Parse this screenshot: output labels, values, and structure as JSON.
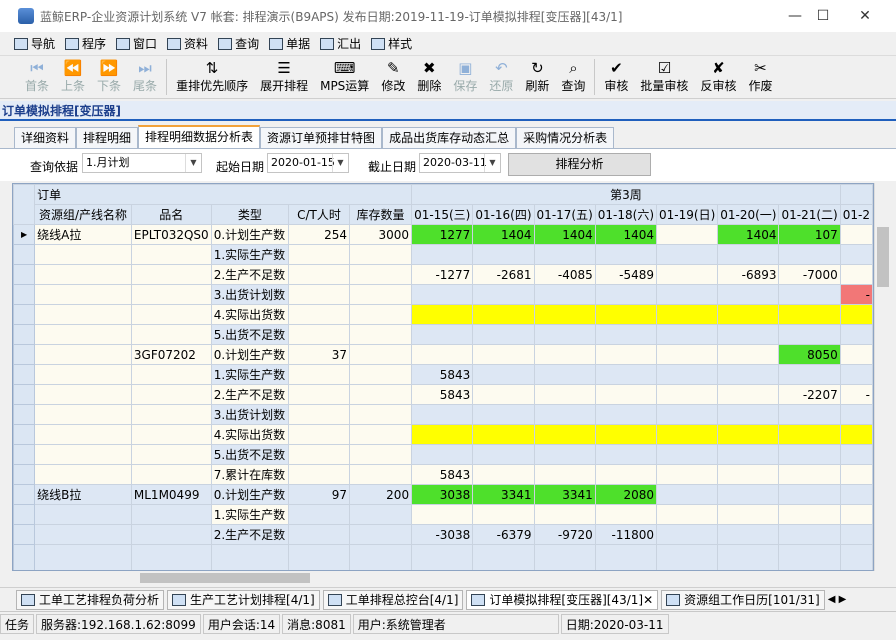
{
  "window": {
    "title": "蓝鲸ERP-企业资源计划系统 V7 帐套: 排程演示(B9APS) 发布日期:2019-11-19-订单模拟排程[变压器][43/1]"
  },
  "menu": [
    "导航",
    "程序",
    "窗口",
    "资料",
    "查询",
    "单据",
    "汇出",
    "样式"
  ],
  "toolbar": [
    {
      "label": "首条",
      "icon": "first-icon",
      "enabled": false
    },
    {
      "label": "上条",
      "icon": "prev-icon",
      "enabled": false
    },
    {
      "label": "下条",
      "icon": "next-icon",
      "enabled": false
    },
    {
      "label": "尾条",
      "icon": "last-icon",
      "enabled": false
    },
    {
      "label": "重排优先顺序",
      "icon": "reorder-icon",
      "enabled": true
    },
    {
      "label": "展开排程",
      "icon": "expand-schedule-icon",
      "enabled": true
    },
    {
      "label": "MPS运算",
      "icon": "mps-icon",
      "enabled": true
    },
    {
      "label": "修改",
      "icon": "edit-icon",
      "enabled": true
    },
    {
      "label": "删除",
      "icon": "delete-icon",
      "enabled": true
    },
    {
      "label": "保存",
      "icon": "save-icon",
      "enabled": false
    },
    {
      "label": "还原",
      "icon": "undo-icon",
      "enabled": false
    },
    {
      "label": "刷新",
      "icon": "refresh-icon",
      "enabled": true
    },
    {
      "label": "查询",
      "icon": "query-icon",
      "enabled": true
    },
    {
      "label": "审核",
      "icon": "approve-icon",
      "enabled": true
    },
    {
      "label": "批量审核",
      "icon": "batch-approve-icon",
      "enabled": true
    },
    {
      "label": "反审核",
      "icon": "unapprove-icon",
      "enabled": true
    },
    {
      "label": "作废",
      "icon": "void-icon",
      "enabled": true
    }
  ],
  "form_title": "订单模拟排程[变压器]",
  "tabs": [
    "详细资料",
    "排程明细",
    "排程明细数据分析表",
    "资源订单预排甘特图",
    "成品出货库存动态汇总",
    "采购情况分析表"
  ],
  "active_tab": 2,
  "query": {
    "basis_label": "查询依据",
    "basis_value": "1.月计划",
    "start_label": "起始日期",
    "start_value": "2020-01-15",
    "end_label": "截止日期",
    "end_value": "2020-03-11",
    "analyze_button": "排程分析"
  },
  "grid": {
    "group_header_left": "订单",
    "week_label": "第3周",
    "columns": [
      "资源组/产线名称",
      "品名",
      "类型",
      "C/T人时",
      "库存数量"
    ],
    "date_columns": [
      "01-15(三)",
      "01-16(四)",
      "01-17(五)",
      "01-18(六)",
      "01-19(日)",
      "01-20(一)",
      "01-21(二)",
      "01-2"
    ],
    "rows": [
      {
        "line": "绕线A拉",
        "item": "EPLT032QS0",
        "type": "0.计划生产数",
        "ct": "254",
        "stock": "3000",
        "cells": [
          "1277",
          "1404",
          "1404",
          "1404",
          "",
          "1404",
          "107",
          ""
        ],
        "colors": [
          "g",
          "g",
          "g",
          "g",
          "",
          "g",
          "g",
          ""
        ],
        "current": true
      },
      {
        "line": "",
        "item": "",
        "type": "1.实际生产数",
        "ct": "",
        "stock": "",
        "cells": [
          "",
          "",
          "",
          "",
          "",
          "",
          "",
          ""
        ],
        "colors": [
          "",
          "",
          "",
          "",
          "",
          "",
          "",
          ""
        ]
      },
      {
        "line": "",
        "item": "",
        "type": "2.生产不足数",
        "ct": "",
        "stock": "",
        "cells": [
          "-1277",
          "-2681",
          "-4085",
          "-5489",
          "",
          "-6893",
          "-7000",
          ""
        ],
        "colors": [
          "",
          "",
          "",
          "",
          "",
          "",
          "",
          ""
        ]
      },
      {
        "line": "",
        "item": "",
        "type": "3.出货计划数",
        "ct": "",
        "stock": "",
        "cells": [
          "",
          "",
          "",
          "",
          "",
          "",
          "",
          "-"
        ],
        "colors": [
          "",
          "",
          "",
          "",
          "",
          "",
          "",
          "r"
        ]
      },
      {
        "line": "",
        "item": "",
        "type": "4.实际出货数",
        "ct": "",
        "stock": "",
        "cells": [
          "",
          "",
          "",
          "",
          "",
          "",
          "",
          ""
        ],
        "colors": [
          "y",
          "y",
          "y",
          "y",
          "y",
          "y",
          "y",
          "y"
        ]
      },
      {
        "line": "",
        "item": "",
        "type": "5.出货不足数",
        "ct": "",
        "stock": "",
        "cells": [
          "",
          "",
          "",
          "",
          "",
          "",
          "",
          ""
        ],
        "colors": [
          "",
          "",
          "",
          "",
          "",
          "",
          "",
          ""
        ]
      },
      {
        "line": "",
        "item": "3GF07202",
        "type": "0.计划生产数",
        "ct": "37",
        "stock": "",
        "cells": [
          "",
          "",
          "",
          "",
          "",
          "",
          "8050",
          ""
        ],
        "colors": [
          "",
          "",
          "",
          "",
          "",
          "",
          "g",
          ""
        ]
      },
      {
        "line": "",
        "item": "",
        "type": "1.实际生产数",
        "ct": "",
        "stock": "",
        "cells": [
          "5843",
          "",
          "",
          "",
          "",
          "",
          "",
          ""
        ],
        "colors": [
          "",
          "",
          "",
          "",
          "",
          "",
          "",
          ""
        ]
      },
      {
        "line": "",
        "item": "",
        "type": "2.生产不足数",
        "ct": "",
        "stock": "",
        "cells": [
          "5843",
          "",
          "",
          "",
          "",
          "",
          "-2207",
          "-"
        ],
        "colors": [
          "",
          "",
          "",
          "",
          "",
          "",
          "",
          ""
        ]
      },
      {
        "line": "",
        "item": "",
        "type": "3.出货计划数",
        "ct": "",
        "stock": "",
        "cells": [
          "",
          "",
          "",
          "",
          "",
          "",
          "",
          ""
        ],
        "colors": [
          "",
          "",
          "",
          "",
          "",
          "",
          "",
          ""
        ]
      },
      {
        "line": "",
        "item": "",
        "type": "4.实际出货数",
        "ct": "",
        "stock": "",
        "cells": [
          "",
          "",
          "",
          "",
          "",
          "",
          "",
          ""
        ],
        "colors": [
          "y",
          "y",
          "y",
          "y",
          "y",
          "y",
          "y",
          "y"
        ]
      },
      {
        "line": "",
        "item": "",
        "type": "5.出货不足数",
        "ct": "",
        "stock": "",
        "cells": [
          "",
          "",
          "",
          "",
          "",
          "",
          "",
          ""
        ],
        "colors": [
          "",
          "",
          "",
          "",
          "",
          "",
          "",
          ""
        ]
      },
      {
        "line": "",
        "item": "",
        "type": "7.累计在库数",
        "ct": "",
        "stock": "",
        "cells": [
          "5843",
          "",
          "",
          "",
          "",
          "",
          "",
          ""
        ],
        "colors": [
          "",
          "",
          "",
          "",
          "",
          "",
          "",
          ""
        ]
      },
      {
        "line": "绕线B拉",
        "item": "ML1M0499",
        "type": "0.计划生产数",
        "ct": "97",
        "stock": "200",
        "cells": [
          "3038",
          "3341",
          "3341",
          "2080",
          "",
          "",
          "",
          ""
        ],
        "colors": [
          "g",
          "g",
          "g",
          "g",
          "",
          "",
          "",
          ""
        ]
      },
      {
        "line": "",
        "item": "",
        "type": "1.实际生产数",
        "ct": "",
        "stock": "",
        "cells": [
          "",
          "",
          "",
          "",
          "",
          "",
          "",
          ""
        ],
        "colors": [
          "",
          "",
          "",
          "",
          "",
          "",
          "",
          ""
        ]
      },
      {
        "line": "",
        "item": "",
        "type": "2.生产不足数",
        "ct": "",
        "stock": "",
        "cells": [
          "-3038",
          "-6379",
          "-9720",
          "-11800",
          "",
          "",
          "",
          ""
        ],
        "colors": [
          "",
          "",
          "",
          "",
          "",
          "",
          "",
          ""
        ]
      }
    ]
  },
  "bottom_tabs": [
    "工单工艺排程负荷分析",
    "生产工艺计划排程[4/1]",
    "工单排程总控台[4/1]",
    "订单模拟排程[变压器][43/1]",
    "资源组工作日历[101/31]"
  ],
  "status": {
    "task": "任务",
    "server": "服务器:192.168.1.62:8099",
    "sessions": "用户会话:14",
    "messages": "消息:8081",
    "user": "用户:系统管理者",
    "date": "日期:2020-03-11"
  }
}
